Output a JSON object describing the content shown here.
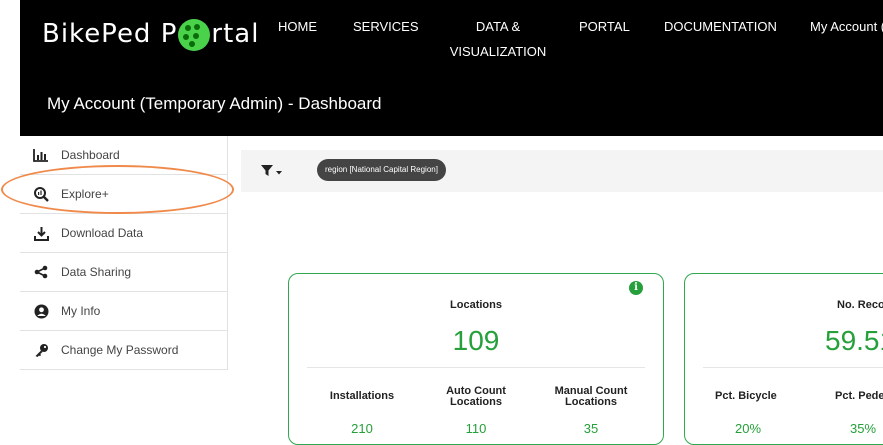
{
  "brand": {
    "part1": "BikePed P",
    "part2": "rtal"
  },
  "nav": {
    "home": "HOME",
    "services": "SERVICES",
    "data_line1": "DATA &",
    "data_line2": "VISUALIZATION",
    "portal": "PORTAL",
    "documentation": "DOCUMENTATION",
    "account": "My Account ("
  },
  "page_header": "My Account (Temporary Admin) - Dashboard",
  "sidebar": {
    "items": [
      {
        "label": "Dashboard",
        "icon": "bar-chart-icon"
      },
      {
        "label": "Explore+",
        "icon": "search-chart-icon"
      },
      {
        "label": "Download Data",
        "icon": "download-icon"
      },
      {
        "label": "Data Sharing",
        "icon": "share-icon"
      },
      {
        "label": "My Info",
        "icon": "user-icon"
      },
      {
        "label": "Change My Password",
        "icon": "key-icon"
      }
    ]
  },
  "filter": {
    "chip": "region [National Capital Region]"
  },
  "cards": {
    "locations": {
      "title": "Locations",
      "value": "109",
      "info": "i",
      "sub": [
        {
          "label": "Installations",
          "value": "210"
        },
        {
          "label_line1": "Auto Count",
          "label_line2": "Locations",
          "value": "110"
        },
        {
          "label_line1": "Manual Count",
          "label_line2": "Locations",
          "value": "35"
        }
      ]
    },
    "records": {
      "title": "No. Reco",
      "value": "59.51",
      "sub": [
        {
          "label": "Pct. Bicycle",
          "value": "20%"
        },
        {
          "label": "Pct. Pede",
          "value": "35%"
        }
      ]
    }
  },
  "colors": {
    "accent_green": "#25a03a",
    "highlight_orange": "#f08a4b",
    "header_bg": "#000000"
  }
}
